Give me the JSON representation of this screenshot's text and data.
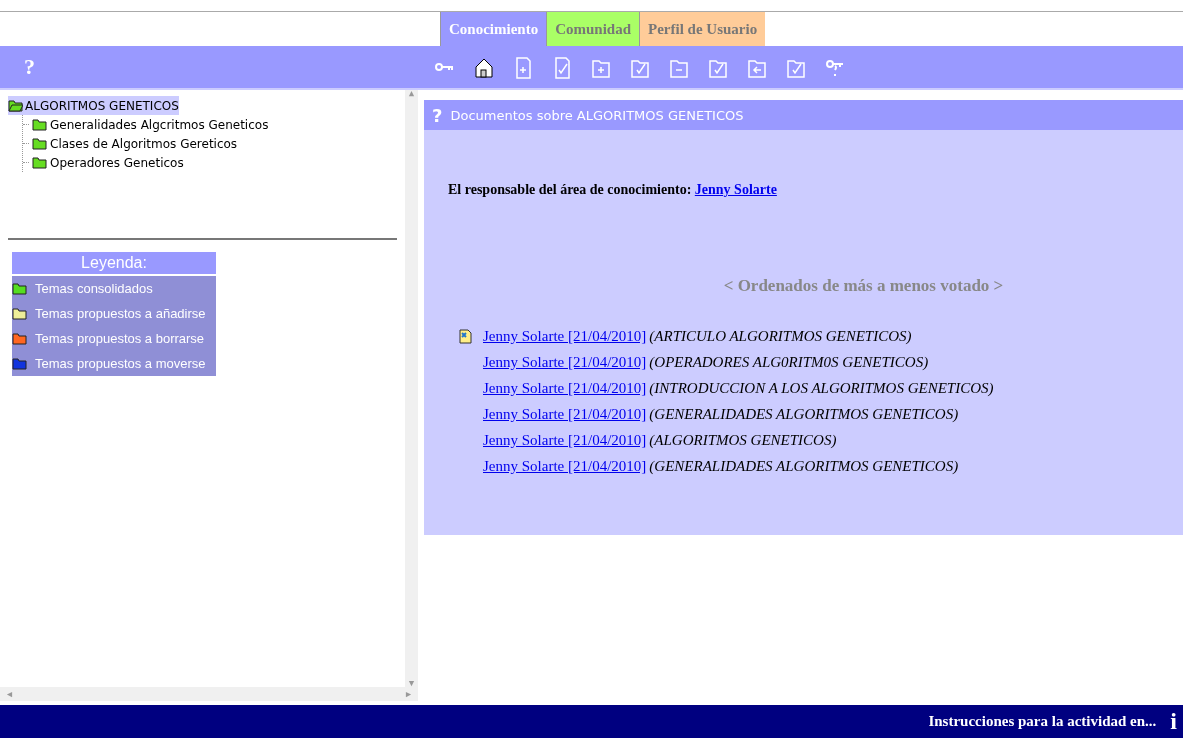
{
  "tabs": [
    {
      "label": "Conocimiento",
      "selected": true,
      "color": "#9999ff"
    },
    {
      "label": "Comunidad",
      "selected": false,
      "color": "#aaff66"
    },
    {
      "label": "Perfil de Usuario",
      "selected": false,
      "color": "#ffcc99"
    }
  ],
  "toolbar": {
    "help": "?"
  },
  "tree": {
    "label": "ALGORITMOS GENETICOS",
    "selected": true,
    "children": [
      {
        "label": "Generalidades Algcritmos Geneticos",
        "color": "#66dd22"
      },
      {
        "label": "Clases de Algoritmos Gereticos",
        "color": "#66dd22"
      },
      {
        "label": "Operadores Geneticos",
        "color": "#66dd22"
      }
    ]
  },
  "legend": {
    "title": "Leyenda:",
    "items": [
      {
        "label": "Temas consolidados",
        "color": "#55dd22"
      },
      {
        "label": "Temas propuestos a añadirse",
        "color": "#eeee99"
      },
      {
        "label": "Temas propuestos a borrarse",
        "color": "#ff6622"
      },
      {
        "label": "Temas propuestos a moverse",
        "color": "#1133dd"
      }
    ]
  },
  "documents": {
    "help": "?",
    "title": "Documentos sobre ALGORITMOS GENETICOS",
    "responsible_label": "El responsable del área de conocimiento:",
    "responsible": "Jenny Solarte",
    "order": "< Ordenados de más a menos votado >",
    "rows": [
      {
        "link": "Jenny Solarte [21/04/2010]",
        "title": "(ARTICULO ALGORITMOS GENETICOS)",
        "marked": true
      },
      {
        "link": "Jenny Solarte [21/04/2010]",
        "title": "(OPERADORES ALG0RITM0S GENETICOS)",
        "marked": false
      },
      {
        "link": "Jenny Solarte [21/04/2010]",
        "title": "(INTRODUCCION A LOS ALGORITMOS GENETICOS)",
        "marked": false
      },
      {
        "link": "Jenny Solarte [21/04/2010]",
        "title": "(GENERALIDADES ALGORITMOS GENETICOS)",
        "marked": false
      },
      {
        "link": "Jenny Solarte [21/04/2010]",
        "title": "(ALGORITMOS GENETICOS)",
        "marked": false
      },
      {
        "link": "Jenny Solarte [21/04/2010]",
        "title": "(GENERALIDADES ALGORITMOS GENETICOS)",
        "marked": false
      }
    ]
  },
  "footer": {
    "text": "Instrucciones para la actividad en...",
    "icon": "i"
  }
}
